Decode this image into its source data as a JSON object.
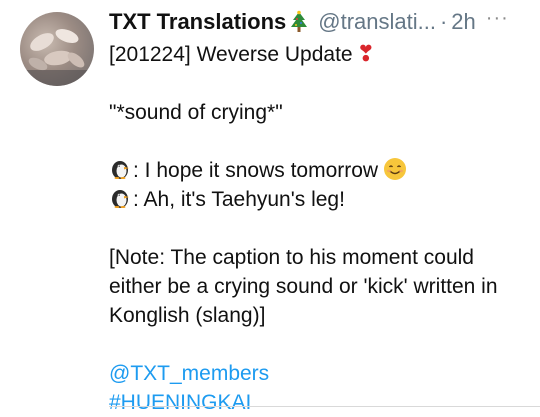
{
  "tweet": {
    "display_name": "TXT Translations",
    "handle": "@translati...",
    "separator": "·",
    "time": "2h",
    "more": "···",
    "lines": {
      "title": "[201224] Weverse Update",
      "heart": "❣",
      "quote": "\"*sound of crying*\"",
      "line1": ": I hope it snows tomorrow",
      "line2": ": Ah, it's Taehyun's leg!",
      "note": "[Note: The caption to his moment could either be a crying sound or 'kick' written in Konglish (slang)]",
      "mention": "@TXT_members",
      "hashtag": "#HUENINGKAI"
    }
  },
  "colors": {
    "link": "#1d9bf0",
    "muted": "#657786",
    "text": "#111111"
  },
  "icons": [
    "avatar-photo",
    "christmas-tree-icon",
    "heart-exclamation-icon",
    "penguin-icon",
    "smiling-face-icon",
    "more-icon"
  ]
}
